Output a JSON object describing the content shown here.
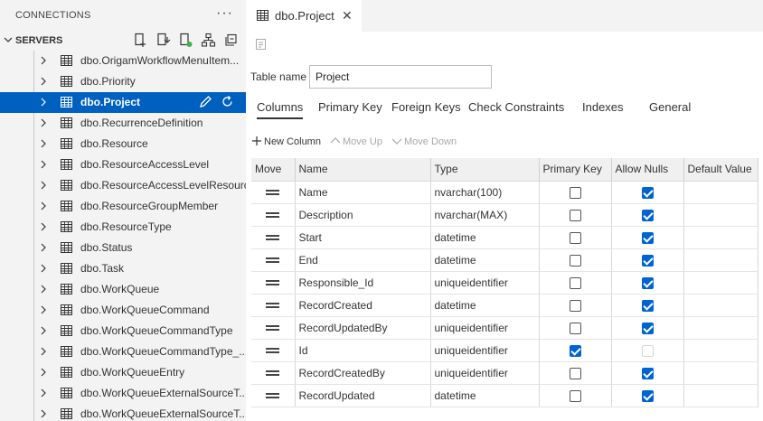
{
  "connections": {
    "title": "CONNECTIONS",
    "more_icon": "ellipsis-icon",
    "more_text": "···"
  },
  "servers": {
    "title": "SERVERS",
    "tools": [
      "new-query-icon",
      "new-connection-icon",
      "connection-status-icon",
      "server-group-icon",
      "collapse-all-icon"
    ]
  },
  "tree": {
    "items": [
      {
        "label": "dbo.OrigamWorkflowMenuItem..."
      },
      {
        "label": "dbo.Priority"
      },
      {
        "label": "dbo.Project",
        "selected": true
      },
      {
        "label": "dbo.RecurrenceDefinition"
      },
      {
        "label": "dbo.Resource"
      },
      {
        "label": "dbo.ResourceAccessLevel"
      },
      {
        "label": "dbo.ResourceAccessLevelResource"
      },
      {
        "label": "dbo.ResourceGroupMember"
      },
      {
        "label": "dbo.ResourceType"
      },
      {
        "label": "dbo.Status"
      },
      {
        "label": "dbo.Task"
      },
      {
        "label": "dbo.WorkQueue"
      },
      {
        "label": "dbo.WorkQueueCommand"
      },
      {
        "label": "dbo.WorkQueueCommandType"
      },
      {
        "label": "dbo.WorkQueueCommandType_..."
      },
      {
        "label": "dbo.WorkQueueEntry"
      },
      {
        "label": "dbo.WorkQueueExternalSourceT..."
      },
      {
        "label": "dbo.WorkQueueExternalSourceT..."
      }
    ]
  },
  "editor": {
    "tab_label": "dbo.Project",
    "close_glyph": "✕",
    "table_name_label": "Table name",
    "table_name_value": "Project",
    "subtabs": [
      "Columns",
      "Primary Key",
      "Foreign Keys",
      "Check Constraints",
      "Indexes",
      "General"
    ],
    "toolbar": {
      "new_column": "New Column",
      "move_up": "Move Up",
      "move_down": "Move Down"
    },
    "headers": {
      "move": "Move",
      "name": "Name",
      "type": "Type",
      "primary_key": "Primary Key",
      "allow_nulls": "Allow Nulls",
      "default_value": "Default Value"
    },
    "rows": [
      {
        "name": "Name",
        "type": "nvarchar(100)",
        "primary_key": false,
        "allow_nulls": true
      },
      {
        "name": "Description",
        "type": "nvarchar(MAX)",
        "primary_key": false,
        "allow_nulls": true
      },
      {
        "name": "Start",
        "type": "datetime",
        "primary_key": false,
        "allow_nulls": true
      },
      {
        "name": "End",
        "type": "datetime",
        "primary_key": false,
        "allow_nulls": true
      },
      {
        "name": "Responsible_Id",
        "type": "uniqueidentifier",
        "primary_key": false,
        "allow_nulls": true
      },
      {
        "name": "RecordCreated",
        "type": "datetime",
        "primary_key": false,
        "allow_nulls": true
      },
      {
        "name": "RecordUpdatedBy",
        "type": "uniqueidentifier",
        "primary_key": false,
        "allow_nulls": true
      },
      {
        "name": "Id",
        "type": "uniqueidentifier",
        "primary_key": true,
        "allow_nulls": false,
        "allow_nulls_disabled": true
      },
      {
        "name": "RecordCreatedBy",
        "type": "uniqueidentifier",
        "primary_key": false,
        "allow_nulls": true
      },
      {
        "name": "RecordUpdated",
        "type": "datetime",
        "primary_key": false,
        "allow_nulls": true
      }
    ]
  },
  "colors": {
    "selection": "#0060c0",
    "checkbox_checked": "#0063d3"
  }
}
